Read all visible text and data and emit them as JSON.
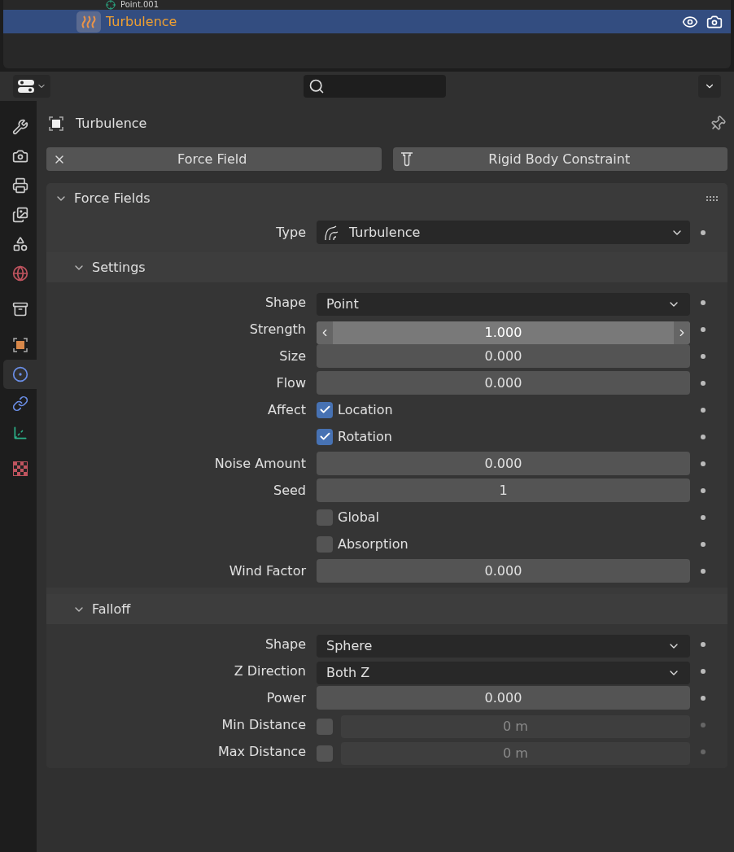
{
  "outliner": {
    "rows": [
      {
        "name": "Point.001",
        "selected": false
      },
      {
        "name": "Turbulence",
        "selected": true
      }
    ]
  },
  "sidebar": {
    "tabs": [
      {
        "kind": "tool",
        "selected": false
      },
      {
        "kind": "render",
        "selected": false
      },
      {
        "kind": "output",
        "selected": false
      },
      {
        "kind": "view_layer",
        "selected": false
      },
      {
        "kind": "scene",
        "selected": false
      },
      {
        "kind": "world",
        "selected": false
      },
      {
        "kind": "collection",
        "selected": false
      },
      {
        "kind": "object",
        "selected": false
      },
      {
        "kind": "physics",
        "selected": true
      },
      {
        "kind": "constraints",
        "selected": false
      },
      {
        "kind": "data",
        "selected": false
      },
      {
        "kind": "texture",
        "selected": false
      }
    ]
  },
  "object": {
    "name": "Turbulence"
  },
  "buttons": [
    {
      "label": "Force Field",
      "kind": "remove"
    },
    {
      "label": "Rigid Body Constraint",
      "kind": "add"
    }
  ],
  "panel": {
    "title": "Force Fields",
    "expanded": true,
    "type": {
      "label": "Type",
      "value": "Turbulence"
    },
    "subpanels": [
      {
        "title": "Settings",
        "expanded": true,
        "properties": [
          {
            "kind": "dropdown",
            "label": "Shape",
            "value": "Point"
          },
          {
            "kind": "stepper",
            "label": "Strength",
            "value": "1.000",
            "hovered": true
          },
          {
            "kind": "number",
            "label": "Size",
            "value": "0.000"
          },
          {
            "kind": "number",
            "label": "Flow",
            "value": "0.000"
          },
          {
            "kind": "checkbox",
            "label": "Affect",
            "text": "Location",
            "checked": true
          },
          {
            "kind": "checkbox",
            "text": "Rotation",
            "checked": true
          },
          {
            "kind": "number",
            "label": "Noise Amount",
            "value": "0.000"
          },
          {
            "kind": "number",
            "label": "Seed",
            "value": "1"
          },
          {
            "kind": "checkbox",
            "text": "Global",
            "checked": false
          },
          {
            "kind": "checkbox",
            "text": "Absorption",
            "checked": false
          },
          {
            "kind": "number",
            "label": "Wind Factor",
            "value": "0.000"
          }
        ]
      },
      {
        "title": "Falloff",
        "expanded": true,
        "properties": [
          {
            "kind": "dropdown",
            "label": "Shape",
            "value": "Sphere"
          },
          {
            "kind": "dropdown",
            "label": "Z Direction",
            "value": "Both Z"
          },
          {
            "kind": "number",
            "label": "Power",
            "value": "0.000"
          },
          {
            "kind": "toggle_number",
            "label": "Min Distance",
            "value": "0 m",
            "checked": false,
            "disabled": true
          },
          {
            "kind": "toggle_number",
            "label": "Max Distance",
            "value": "0 m",
            "checked": false,
            "disabled": true
          }
        ]
      }
    ]
  }
}
